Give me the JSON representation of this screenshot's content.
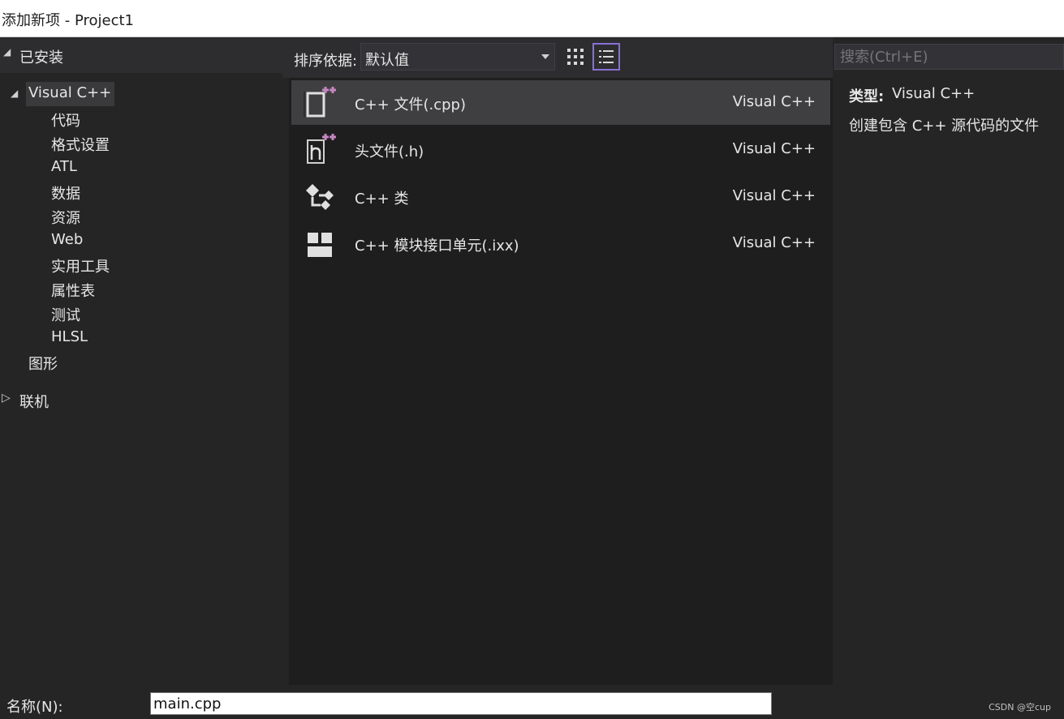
{
  "window": {
    "title": "添加新项 - Project1"
  },
  "left": {
    "installed_label": "已安装",
    "tree_root": "Visual C++",
    "children": [
      "代码",
      "格式设置",
      "ATL",
      "数据",
      "资源",
      "Web",
      "实用工具",
      "属性表",
      "测试",
      "HLSL"
    ],
    "graphics": "图形",
    "online_label": "联机"
  },
  "toolbar": {
    "sort_label": "排序依据:",
    "sort_value": "默认值"
  },
  "items": [
    {
      "name": "C++ 文件(.cpp)",
      "category": "Visual C++",
      "icon": "cpp-file-icon",
      "selected": true
    },
    {
      "name": "头文件(.h)",
      "category": "Visual C++",
      "icon": "header-file-icon",
      "selected": false
    },
    {
      "name": "C++ 类",
      "category": "Visual C++",
      "icon": "class-icon",
      "selected": false
    },
    {
      "name": "C++ 模块接口单元(.ixx)",
      "category": "Visual C++",
      "icon": "module-icon",
      "selected": false
    }
  ],
  "details": {
    "search_placeholder": "搜索(Ctrl+E)",
    "type_label": "类型:",
    "type_value": "Visual C++",
    "description": "创建包含 C++ 源代码的文件"
  },
  "bottom": {
    "name_label": "名称(N):",
    "name_value": "main.cpp",
    "watermark": "CSDN @空cup"
  },
  "colors": {
    "accent": "#8a6fd8",
    "plus": "#c586c0",
    "selection": "#3f3f41"
  }
}
